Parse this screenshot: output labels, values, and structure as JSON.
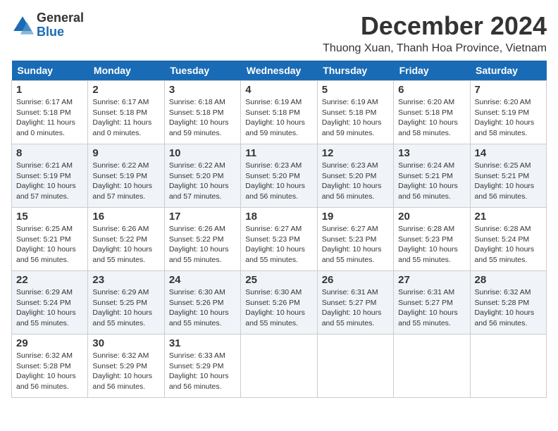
{
  "logo": {
    "general": "General",
    "blue": "Blue"
  },
  "header": {
    "month": "December 2024",
    "location": "Thuong Xuan, Thanh Hoa Province, Vietnam"
  },
  "weekdays": [
    "Sunday",
    "Monday",
    "Tuesday",
    "Wednesday",
    "Thursday",
    "Friday",
    "Saturday"
  ],
  "weeks": [
    [
      {
        "day": "1",
        "sunrise": "6:17 AM",
        "sunset": "5:18 PM",
        "daylight": "11 hours and 0 minutes."
      },
      {
        "day": "2",
        "sunrise": "6:17 AM",
        "sunset": "5:18 PM",
        "daylight": "11 hours and 0 minutes."
      },
      {
        "day": "3",
        "sunrise": "6:18 AM",
        "sunset": "5:18 PM",
        "daylight": "10 hours and 59 minutes."
      },
      {
        "day": "4",
        "sunrise": "6:19 AM",
        "sunset": "5:18 PM",
        "daylight": "10 hours and 59 minutes."
      },
      {
        "day": "5",
        "sunrise": "6:19 AM",
        "sunset": "5:18 PM",
        "daylight": "10 hours and 59 minutes."
      },
      {
        "day": "6",
        "sunrise": "6:20 AM",
        "sunset": "5:18 PM",
        "daylight": "10 hours and 58 minutes."
      },
      {
        "day": "7",
        "sunrise": "6:20 AM",
        "sunset": "5:19 PM",
        "daylight": "10 hours and 58 minutes."
      }
    ],
    [
      {
        "day": "8",
        "sunrise": "6:21 AM",
        "sunset": "5:19 PM",
        "daylight": "10 hours and 57 minutes."
      },
      {
        "day": "9",
        "sunrise": "6:22 AM",
        "sunset": "5:19 PM",
        "daylight": "10 hours and 57 minutes."
      },
      {
        "day": "10",
        "sunrise": "6:22 AM",
        "sunset": "5:20 PM",
        "daylight": "10 hours and 57 minutes."
      },
      {
        "day": "11",
        "sunrise": "6:23 AM",
        "sunset": "5:20 PM",
        "daylight": "10 hours and 56 minutes."
      },
      {
        "day": "12",
        "sunrise": "6:23 AM",
        "sunset": "5:20 PM",
        "daylight": "10 hours and 56 minutes."
      },
      {
        "day": "13",
        "sunrise": "6:24 AM",
        "sunset": "5:21 PM",
        "daylight": "10 hours and 56 minutes."
      },
      {
        "day": "14",
        "sunrise": "6:25 AM",
        "sunset": "5:21 PM",
        "daylight": "10 hours and 56 minutes."
      }
    ],
    [
      {
        "day": "15",
        "sunrise": "6:25 AM",
        "sunset": "5:21 PM",
        "daylight": "10 hours and 56 minutes."
      },
      {
        "day": "16",
        "sunrise": "6:26 AM",
        "sunset": "5:22 PM",
        "daylight": "10 hours and 55 minutes."
      },
      {
        "day": "17",
        "sunrise": "6:26 AM",
        "sunset": "5:22 PM",
        "daylight": "10 hours and 55 minutes."
      },
      {
        "day": "18",
        "sunrise": "6:27 AM",
        "sunset": "5:23 PM",
        "daylight": "10 hours and 55 minutes."
      },
      {
        "day": "19",
        "sunrise": "6:27 AM",
        "sunset": "5:23 PM",
        "daylight": "10 hours and 55 minutes."
      },
      {
        "day": "20",
        "sunrise": "6:28 AM",
        "sunset": "5:23 PM",
        "daylight": "10 hours and 55 minutes."
      },
      {
        "day": "21",
        "sunrise": "6:28 AM",
        "sunset": "5:24 PM",
        "daylight": "10 hours and 55 minutes."
      }
    ],
    [
      {
        "day": "22",
        "sunrise": "6:29 AM",
        "sunset": "5:24 PM",
        "daylight": "10 hours and 55 minutes."
      },
      {
        "day": "23",
        "sunrise": "6:29 AM",
        "sunset": "5:25 PM",
        "daylight": "10 hours and 55 minutes."
      },
      {
        "day": "24",
        "sunrise": "6:30 AM",
        "sunset": "5:26 PM",
        "daylight": "10 hours and 55 minutes."
      },
      {
        "day": "25",
        "sunrise": "6:30 AM",
        "sunset": "5:26 PM",
        "daylight": "10 hours and 55 minutes."
      },
      {
        "day": "26",
        "sunrise": "6:31 AM",
        "sunset": "5:27 PM",
        "daylight": "10 hours and 55 minutes."
      },
      {
        "day": "27",
        "sunrise": "6:31 AM",
        "sunset": "5:27 PM",
        "daylight": "10 hours and 55 minutes."
      },
      {
        "day": "28",
        "sunrise": "6:32 AM",
        "sunset": "5:28 PM",
        "daylight": "10 hours and 56 minutes."
      }
    ],
    [
      {
        "day": "29",
        "sunrise": "6:32 AM",
        "sunset": "5:28 PM",
        "daylight": "10 hours and 56 minutes."
      },
      {
        "day": "30",
        "sunrise": "6:32 AM",
        "sunset": "5:29 PM",
        "daylight": "10 hours and 56 minutes."
      },
      {
        "day": "31",
        "sunrise": "6:33 AM",
        "sunset": "5:29 PM",
        "daylight": "10 hours and 56 minutes."
      },
      null,
      null,
      null,
      null
    ]
  ]
}
